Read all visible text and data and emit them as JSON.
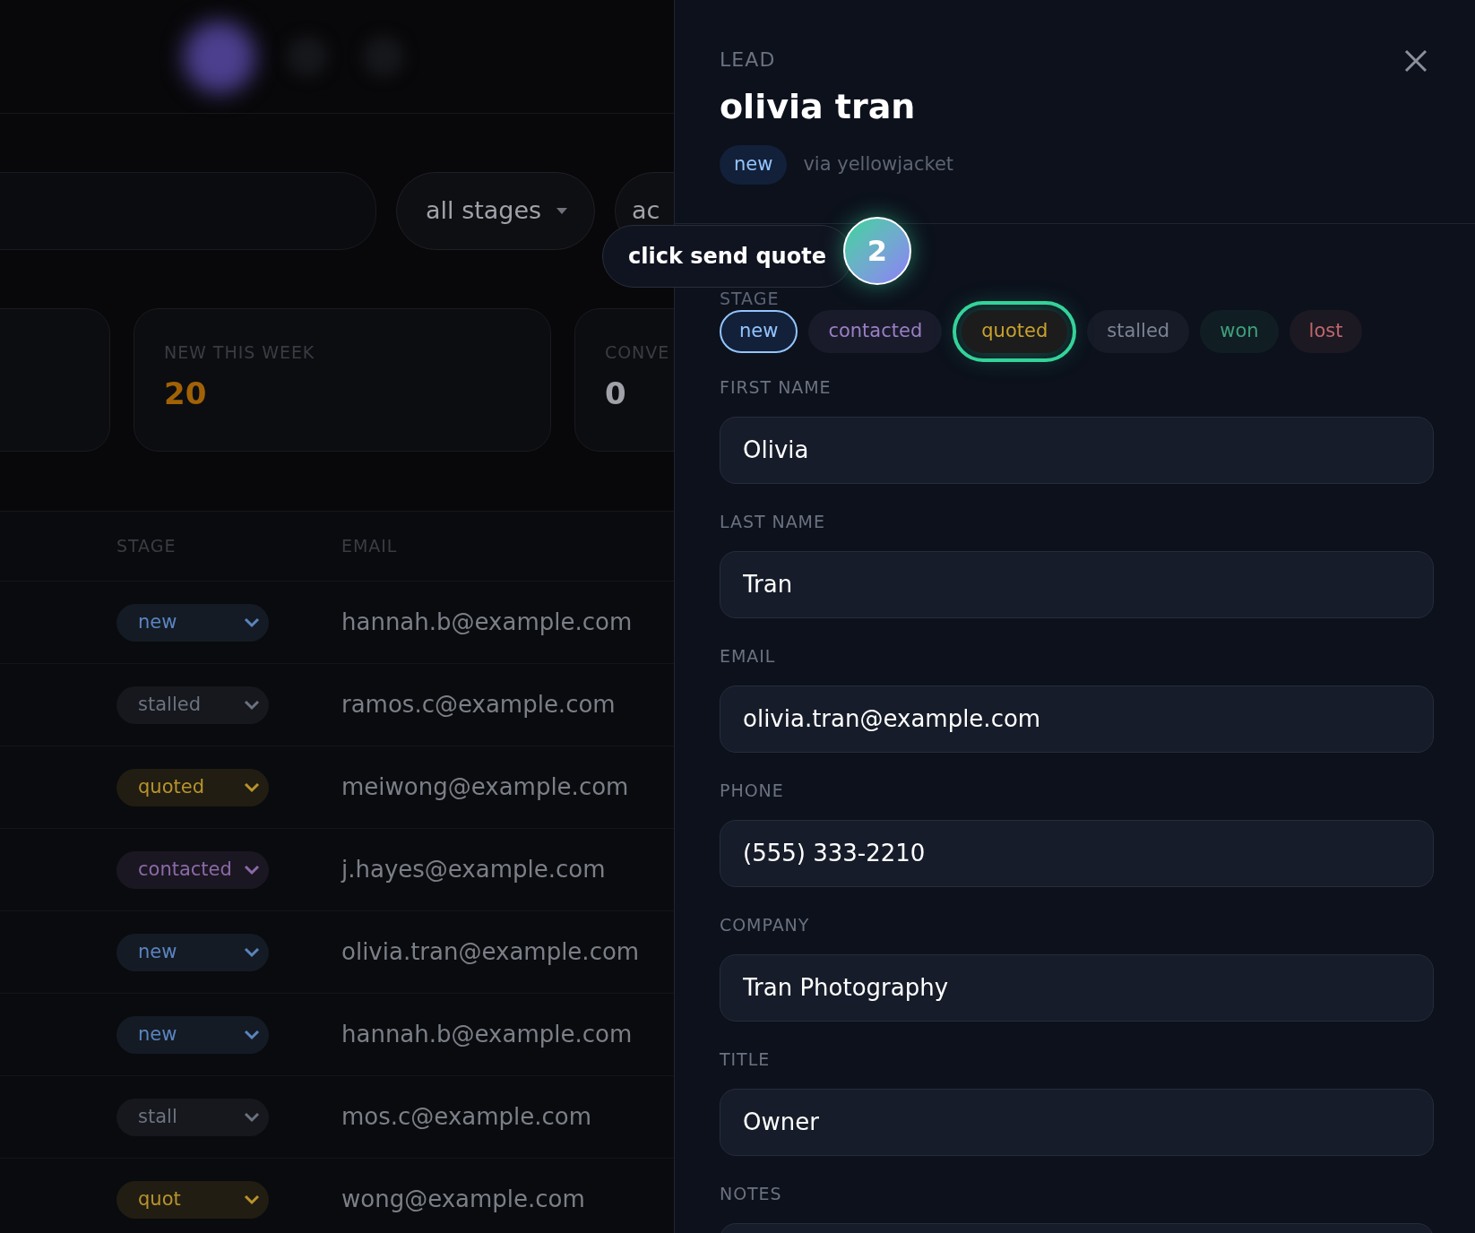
{
  "filters": {
    "stage_dropdown": "all stages",
    "next_dropdown": "ac"
  },
  "stats": [
    {
      "label": "NEW THIS WEEK",
      "value": "20",
      "color": "#a16207"
    },
    {
      "label": "CONVE",
      "value": "0",
      "color": "#a1a1aa"
    }
  ],
  "table": {
    "columns": [
      "STAGE",
      "EMAIL"
    ],
    "rows": [
      {
        "stage": "new",
        "color": "#5b84bf",
        "email": "hannah.b@example.com"
      },
      {
        "stage": "stalled",
        "color": "#6b7280",
        "email": "ramos.c@example.com"
      },
      {
        "stage": "quoted",
        "color": "#b8932c",
        "email": "meiwong@example.com"
      },
      {
        "stage": "contacted",
        "color": "#8b6aa8",
        "email": "j.hayes@example.com"
      },
      {
        "stage": "new",
        "color": "#5b84bf",
        "email": "olivia.tran@example.com"
      },
      {
        "stage": "new",
        "color": "#5b84bf",
        "email": "hannah.b@example.com"
      },
      {
        "stage": "stall",
        "color": "#6b7280",
        "email": "mos.c@example.com"
      },
      {
        "stage": "quot",
        "color": "#b8932c",
        "email": "wong@example.com"
      }
    ]
  },
  "panel": {
    "eyebrow": "LEAD",
    "title": "olivia tran",
    "badge": "new",
    "source": "via yellowjacket",
    "stage_label": "STAGE",
    "stages": [
      {
        "label": "new",
        "color": "#93c5fd",
        "selected": true,
        "spotlight": false
      },
      {
        "label": "contacted",
        "color": "#9b7fc4",
        "selected": false,
        "spotlight": false
      },
      {
        "label": "quoted",
        "color": "#c9a22e",
        "selected": false,
        "spotlight": true
      },
      {
        "label": "stalled",
        "color": "#7c8494",
        "selected": false,
        "spotlight": false
      },
      {
        "label": "won",
        "color": "#3f9f7a",
        "selected": false,
        "spotlight": false
      },
      {
        "label": "lost",
        "color": "#c0666b",
        "selected": false,
        "spotlight": false
      }
    ],
    "fields": [
      {
        "label": "FIRST NAME",
        "value": "Olivia"
      },
      {
        "label": "LAST NAME",
        "value": "Tran"
      },
      {
        "label": "EMAIL",
        "value": "olivia.tran@example.com"
      },
      {
        "label": "PHONE",
        "value": "(555) 333-2210"
      },
      {
        "label": "COMPANY",
        "value": "Tran Photography"
      },
      {
        "label": "TITLE",
        "value": "Owner"
      },
      {
        "label": "NOTES"
      }
    ]
  },
  "tour": {
    "step": "2",
    "text": "click send quote"
  }
}
